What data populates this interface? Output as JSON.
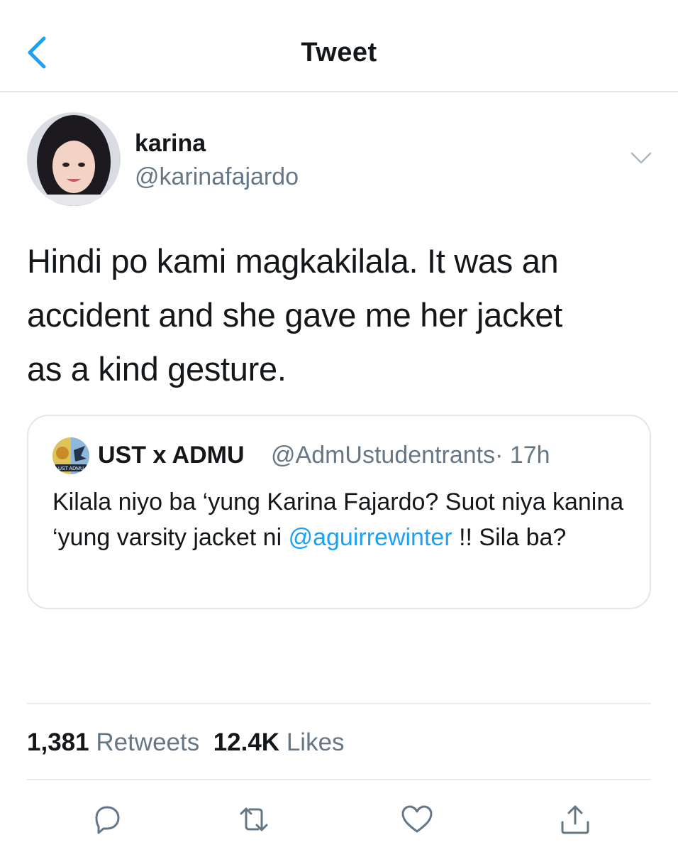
{
  "header": {
    "title": "Tweet"
  },
  "author": {
    "name": "karina",
    "handle": "@karinafajardo"
  },
  "tweet": {
    "line1": "Hindi po kami magkakilala. It was an",
    "line2": "accident and she gave me her jacket",
    "line3": "as a kind gesture."
  },
  "quoted": {
    "name": "UST x ADMU",
    "handle": "@AdmUstudentrants",
    "time": "· 17h",
    "text_part1": "Kilala niyo ba ‘yung Karina Fajardo? Suot niya kanina ‘yung varsity jacket ni ",
    "mention": "@aguirrewinter",
    "text_part2": " !! Sila ba?",
    "avatar_text": "UST ADMU"
  },
  "stats": {
    "retweets_count": "1,381",
    "retweets_label": "Retweets",
    "likes_count": "12.4K",
    "likes_label": "Likes"
  },
  "colors": {
    "accent": "#1da1f2",
    "secondary_text": "#657786",
    "divider": "#e6ecf0"
  },
  "icons": [
    "chevron-left-icon",
    "chevron-down-icon",
    "reply-icon",
    "retweet-icon",
    "like-icon",
    "share-icon"
  ]
}
